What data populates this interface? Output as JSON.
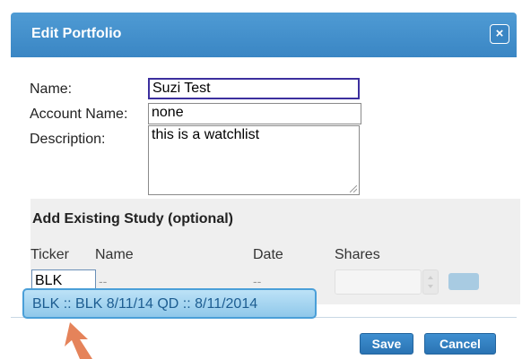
{
  "dialog": {
    "title": "Edit Portfolio",
    "close_label": "×"
  },
  "form": {
    "name_label": "Name:",
    "name_value": "Suzi Test",
    "account_label": "Account Name:",
    "account_value": "none",
    "description_label": "Description:",
    "description_value": "this is a watchlist"
  },
  "study": {
    "title": "Add Existing Study (optional)",
    "columns": {
      "ticker": "Ticker",
      "name": "Name",
      "date": "Date",
      "shares": "Shares"
    },
    "ticker_value": "BLK",
    "name_placeholder": "--",
    "date_placeholder": "--",
    "suggestion": "BLK :: BLK 8/11/14 QD :: 8/11/2014"
  },
  "buttons": {
    "save": "Save",
    "cancel": "Cancel"
  },
  "colors": {
    "titlebar": "#3a86c4",
    "accent_button": "#2a73b3",
    "suggestion_bg": "#a9d6f1",
    "arrow": "#e5835a"
  }
}
